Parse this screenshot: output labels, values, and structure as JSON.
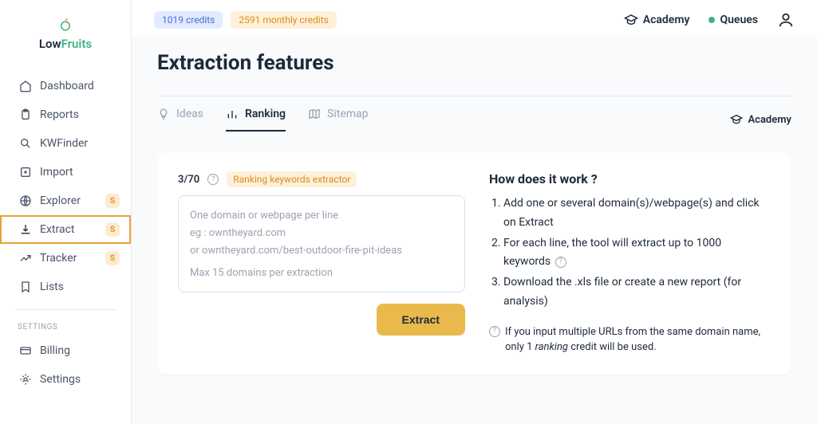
{
  "brand": {
    "low": "Low",
    "fruits": "Fruits"
  },
  "sidebar": {
    "items": [
      {
        "label": "Dashboard"
      },
      {
        "label": "Reports"
      },
      {
        "label": "KWFinder"
      },
      {
        "label": "Import"
      },
      {
        "label": "Explorer",
        "badge": "S"
      },
      {
        "label": "Extract",
        "badge": "S"
      },
      {
        "label": "Tracker",
        "badge": "S"
      },
      {
        "label": "Lists"
      }
    ],
    "settings_heading": "SETTINGS",
    "settings": [
      {
        "label": "Billing"
      },
      {
        "label": "Settings"
      }
    ]
  },
  "topbar": {
    "credits": "1019 credits",
    "monthly_credits": "2591 monthly credits",
    "academy": "Academy",
    "queues": "Queues"
  },
  "page": {
    "title": "Extraction features"
  },
  "tabs": {
    "ideas": "Ideas",
    "ranking": "Ranking",
    "sitemap": "Sitemap",
    "academy": "Academy"
  },
  "extractor": {
    "counter": "3/70",
    "badge": "Ranking keywords extractor",
    "placeholder_l1": "One domain or webpage per line",
    "placeholder_l2": "eg : owntheyard.com",
    "placeholder_l3": "or owntheyard.com/best-outdoor-fire-pit-ideas",
    "max_note": "Max 15 domains per extraction",
    "button": "Extract"
  },
  "how": {
    "title": "How does it work ?",
    "steps": [
      "Add one or several domain(s)/webpage(s) and click on Extract",
      "For each line, the tool will extract up to 1000 keywords",
      "Download the .xls file or create a new report (for analysis)"
    ],
    "note_prefix": "If you input multiple URLs from the same domain name, only 1 ",
    "note_italic": "ranking",
    "note_suffix": " credit will be used."
  }
}
